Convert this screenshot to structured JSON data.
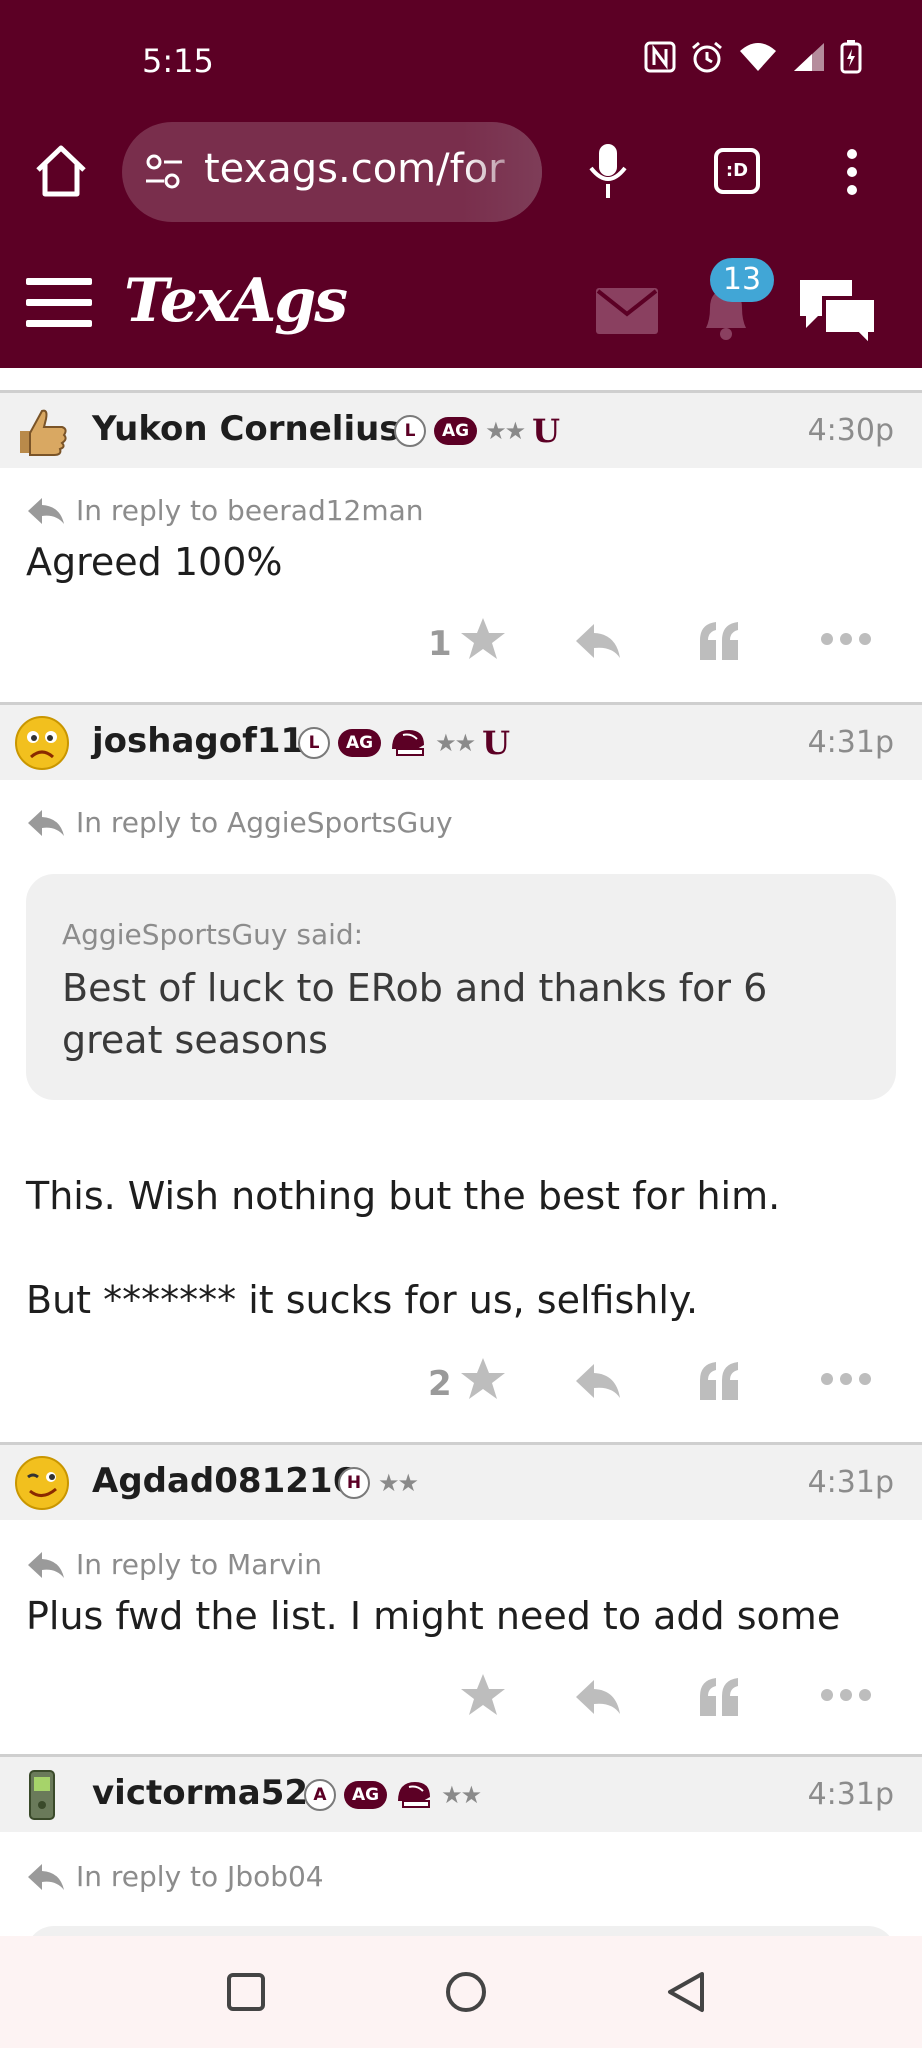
{
  "status_bar": {
    "time": "5:15"
  },
  "browser": {
    "url": "texags.com/for",
    "tabs_label": ":D"
  },
  "site": {
    "logo": "TexAgs",
    "notification_count": "13"
  },
  "posts": [
    {
      "username": "Yukon Cornelius",
      "rank_badge": "L",
      "ag_badge": "AG",
      "stars": "★★",
      "time": "4:30p",
      "reply_to": "In reply to beerad12man",
      "text": "Agreed 100%",
      "likes": "1"
    },
    {
      "username": "joshagof11",
      "rank_badge": "L",
      "ag_badge": "AG",
      "stars": "★★",
      "time": "4:31p",
      "reply_to": "In reply to AggieSportsGuy",
      "quote_author": "AggieSportsGuy said:",
      "quote_text": "Best of luck to ERob and thanks for 6 great seasons",
      "text_line1": "This. Wish nothing but the best for him.",
      "text_line2": "But ******* it sucks for us, selfishly.",
      "likes": "2"
    },
    {
      "username": "Agdad081216",
      "rank_badge": "H",
      "stars": "★★",
      "time": "4:31p",
      "reply_to": "In reply to Marvin",
      "text": "Plus fwd the list. I might need to add some",
      "likes": ""
    },
    {
      "username": "victorma52",
      "rank_badge": "A",
      "ag_badge": "AG",
      "stars": "★★",
      "time": "4:31p",
      "reply_to": "In reply to Jbob04"
    }
  ],
  "colors": {
    "maroon": "#5c0025",
    "badge_blue": "#41a6d6",
    "muted": "#8c8c8c"
  }
}
